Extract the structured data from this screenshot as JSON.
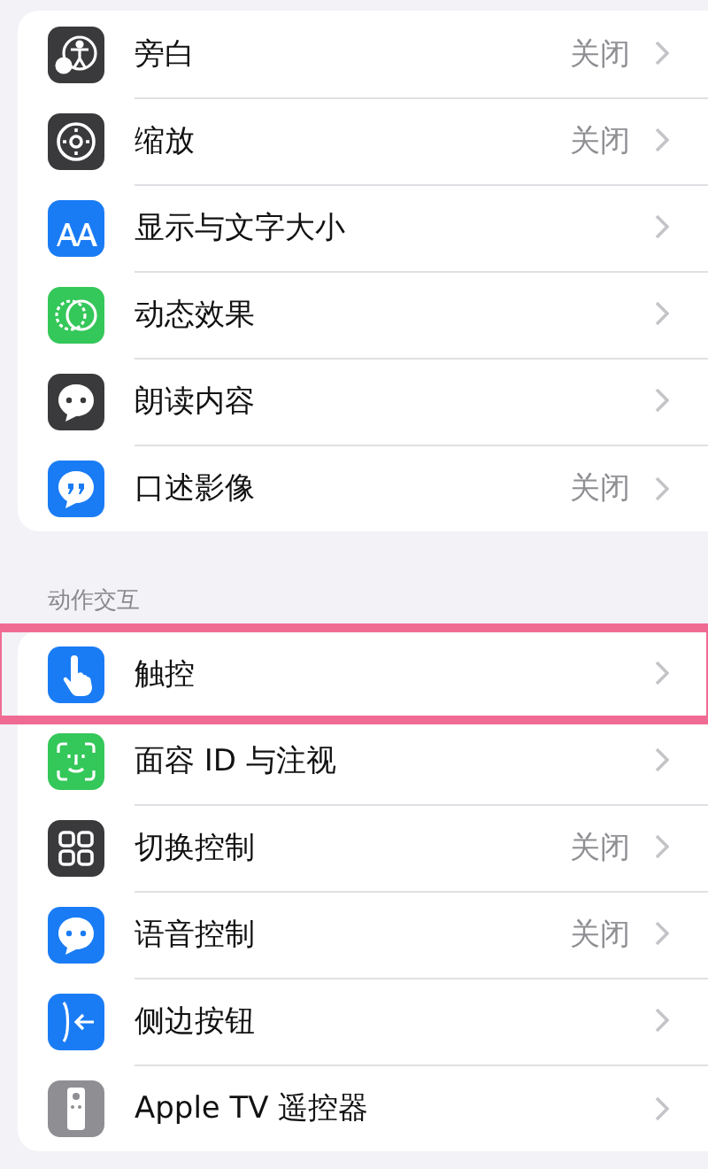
{
  "groups": [
    {
      "items": [
        {
          "kind": "voiceover",
          "label": "旁白",
          "value": "关闭",
          "highlighted": false
        },
        {
          "kind": "zoom",
          "label": "缩放",
          "value": "关闭",
          "highlighted": false
        },
        {
          "kind": "text-size",
          "label": "显示与文字大小",
          "highlighted": false
        },
        {
          "kind": "motion",
          "label": "动态效果",
          "highlighted": false
        },
        {
          "kind": "spoken",
          "label": "朗读内容",
          "highlighted": false
        },
        {
          "kind": "audio-desc",
          "label": "口述影像",
          "value": "关闭",
          "highlighted": false
        }
      ]
    },
    {
      "header": "动作交互",
      "items": [
        {
          "kind": "touch",
          "label": "触控",
          "highlighted": true
        },
        {
          "kind": "face-id",
          "label": "面容 ID 与注视",
          "highlighted": false
        },
        {
          "kind": "switch",
          "label": "切换控制",
          "value": "关闭",
          "highlighted": false
        },
        {
          "kind": "voice",
          "label": "语音控制",
          "value": "关闭",
          "highlighted": false
        },
        {
          "kind": "side",
          "label": "侧边按钮",
          "highlighted": false
        },
        {
          "kind": "remote",
          "label": "Apple TV 遥控器",
          "highlighted": false
        }
      ]
    }
  ]
}
